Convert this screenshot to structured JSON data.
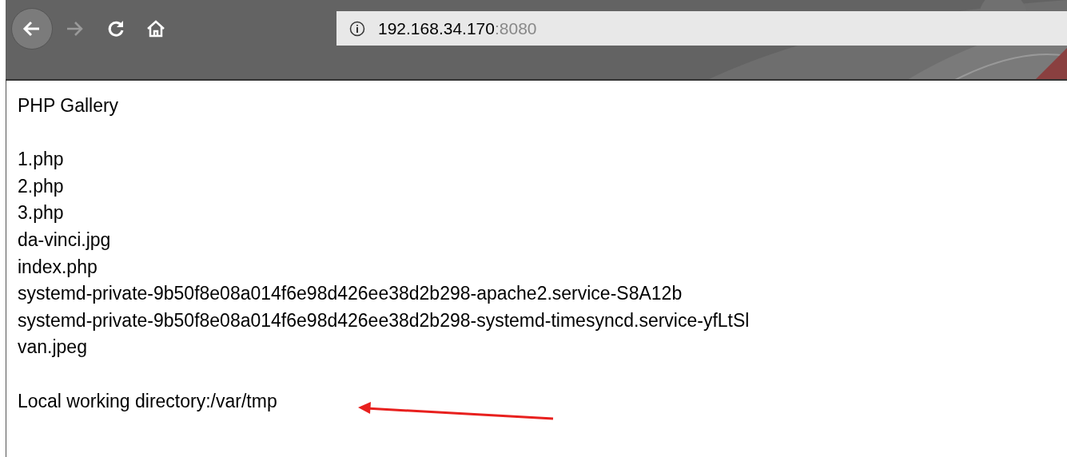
{
  "toolbar": {
    "url_host": "192.168.34.170",
    "url_port": ":8080"
  },
  "page": {
    "title": "PHP Gallery",
    "files": [
      "1.php",
      "2.php",
      "3.php",
      "da-vinci.jpg",
      "index.php",
      "systemd-private-9b50f8e08a014f6e98d426ee38d2b298-apache2.service-S8A12b",
      "systemd-private-9b50f8e08a014f6e98d426ee38d2b298-systemd-timesyncd.service-yfLtSl",
      "van.jpeg"
    ],
    "working_directory": "Local working directory:/var/tmp"
  }
}
